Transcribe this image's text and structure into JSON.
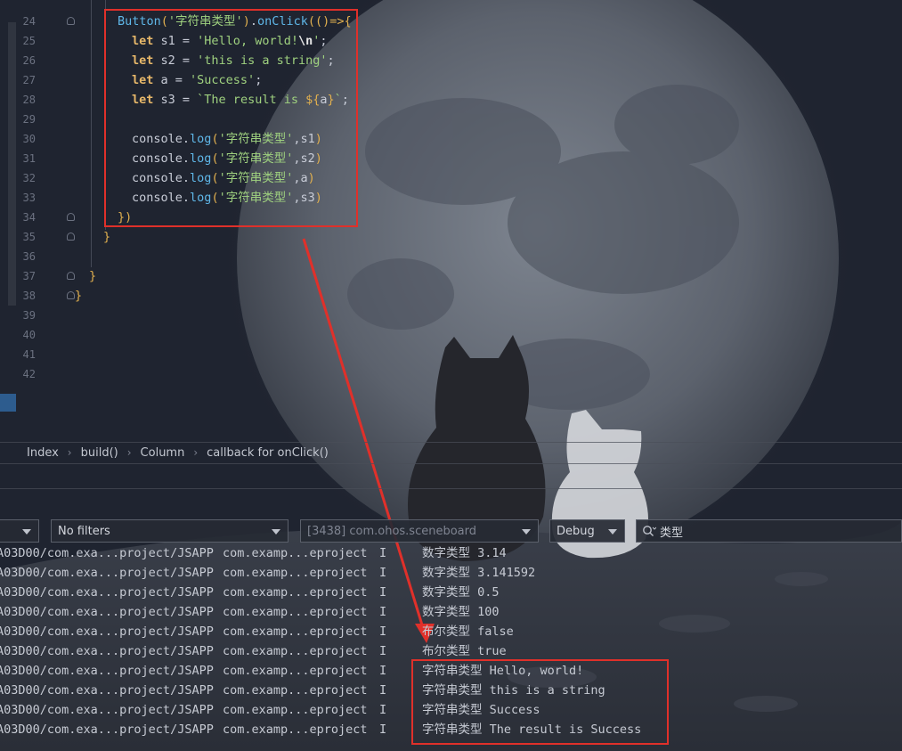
{
  "editor": {
    "lines": [
      {
        "n": "24",
        "tokens": [
          [
            "fn",
            "Button"
          ],
          [
            "par",
            "("
          ],
          [
            "str",
            "'字符串类型'"
          ],
          [
            "par",
            ")"
          ],
          [
            "punct",
            "."
          ],
          [
            "fn",
            "onClick"
          ],
          [
            "par",
            "(()=>{"
          ]
        ]
      },
      {
        "n": "25",
        "tokens": [
          [
            "kw",
            "let"
          ],
          [
            "id",
            " s1 = "
          ],
          [
            "str",
            "'Hello, world!"
          ],
          [
            "esc",
            "\\n"
          ],
          [
            "str",
            "'"
          ],
          [
            "punct",
            ";"
          ]
        ]
      },
      {
        "n": "26",
        "tokens": [
          [
            "kw",
            "let"
          ],
          [
            "id",
            " s2 = "
          ],
          [
            "str",
            "'this is a string'"
          ],
          [
            "punct",
            ";"
          ]
        ]
      },
      {
        "n": "27",
        "tokens": [
          [
            "kw",
            "let"
          ],
          [
            "id",
            " a = "
          ],
          [
            "str",
            "'Success'"
          ],
          [
            "punct",
            ";"
          ]
        ]
      },
      {
        "n": "28",
        "tokens": [
          [
            "kw",
            "let"
          ],
          [
            "id",
            " s3 = "
          ],
          [
            "str",
            "`The result is "
          ],
          [
            "par",
            "${"
          ],
          [
            "id",
            "a"
          ],
          [
            "par",
            "}"
          ],
          [
            "str",
            "`"
          ],
          [
            "punct",
            ";"
          ]
        ]
      },
      {
        "n": "29",
        "tokens": []
      },
      {
        "n": "30",
        "tokens": [
          [
            "id",
            "console"
          ],
          [
            "punct",
            "."
          ],
          [
            "fn",
            "log"
          ],
          [
            "par",
            "("
          ],
          [
            "str",
            "'字符串类型'"
          ],
          [
            "punct",
            ","
          ],
          [
            "id",
            "s1"
          ],
          [
            "par",
            ")"
          ]
        ]
      },
      {
        "n": "31",
        "tokens": [
          [
            "id",
            "console"
          ],
          [
            "punct",
            "."
          ],
          [
            "fn",
            "log"
          ],
          [
            "par",
            "("
          ],
          [
            "str",
            "'字符串类型'"
          ],
          [
            "punct",
            ","
          ],
          [
            "id",
            "s2"
          ],
          [
            "par",
            ")"
          ]
        ]
      },
      {
        "n": "32",
        "tokens": [
          [
            "id",
            "console"
          ],
          [
            "punct",
            "."
          ],
          [
            "fn",
            "log"
          ],
          [
            "par",
            "("
          ],
          [
            "str",
            "'字符串类型'"
          ],
          [
            "punct",
            ","
          ],
          [
            "id",
            "a"
          ],
          [
            "par",
            ")"
          ]
        ]
      },
      {
        "n": "33",
        "tokens": [
          [
            "id",
            "console"
          ],
          [
            "punct",
            "."
          ],
          [
            "fn",
            "log"
          ],
          [
            "par",
            "("
          ],
          [
            "str",
            "'字符串类型'"
          ],
          [
            "punct",
            ","
          ],
          [
            "id",
            "s3"
          ],
          [
            "par",
            ")"
          ]
        ]
      },
      {
        "n": "34",
        "tokens": [
          [
            "par",
            "})"
          ]
        ]
      },
      {
        "n": "35",
        "tokens": [
          [
            "par",
            "}"
          ]
        ]
      },
      {
        "n": "36",
        "tokens": []
      },
      {
        "n": "37",
        "tokens": [
          [
            "par",
            "}"
          ]
        ]
      },
      {
        "n": "38",
        "tokens": [
          [
            "par",
            "}"
          ]
        ]
      },
      {
        "n": "39",
        "tokens": []
      },
      {
        "n": "40",
        "tokens": []
      },
      {
        "n": "41",
        "tokens": []
      },
      {
        "n": "42",
        "tokens": []
      }
    ]
  },
  "breadcrumb": [
    "Index",
    "build()",
    "Column",
    "callback for onClick()"
  ],
  "log_toolbar": {
    "filter": "No filters",
    "process": "[3438] com.ohos.sceneboard",
    "level": "Debug",
    "search_value": "类型"
  },
  "log_rows": [
    {
      "tag": "A03D00/com.exa...project/JSAPP",
      "pkg": "com.examp...eproject",
      "level": "I",
      "msg": "数字类型 3.14"
    },
    {
      "tag": "A03D00/com.exa...project/JSAPP",
      "pkg": "com.examp...eproject",
      "level": "I",
      "msg": "数字类型 3.141592"
    },
    {
      "tag": "A03D00/com.exa...project/JSAPP",
      "pkg": "com.examp...eproject",
      "level": "I",
      "msg": "数字类型 0.5"
    },
    {
      "tag": "A03D00/com.exa...project/JSAPP",
      "pkg": "com.examp...eproject",
      "level": "I",
      "msg": "数字类型 100"
    },
    {
      "tag": "A03D00/com.exa...project/JSAPP",
      "pkg": "com.examp...eproject",
      "level": "I",
      "msg": "布尔类型 false"
    },
    {
      "tag": "A03D00/com.exa...project/JSAPP",
      "pkg": "com.examp...eproject",
      "level": "I",
      "msg": "布尔类型 true"
    },
    {
      "tag": "A03D00/com.exa...project/JSAPP",
      "pkg": "com.examp...eproject",
      "level": "I",
      "msg": "字符串类型 Hello, world!"
    },
    {
      "tag": "A03D00/com.exa...project/JSAPP",
      "pkg": "com.examp...eproject",
      "level": "I",
      "msg": "字符串类型 this is a string"
    },
    {
      "tag": "A03D00/com.exa...project/JSAPP",
      "pkg": "com.examp...eproject",
      "level": "I",
      "msg": "字符串类型 Success"
    },
    {
      "tag": "A03D00/com.exa...project/JSAPP",
      "pkg": "com.examp...eproject",
      "level": "I",
      "msg": "字符串类型 The result is Success"
    }
  ],
  "colors": {
    "annotation": "#e0302a",
    "background": "#1f2430"
  },
  "icons": [
    "search-icon",
    "chevron-down-icon",
    "fold-marker-icon",
    "annotation-arrow"
  ]
}
